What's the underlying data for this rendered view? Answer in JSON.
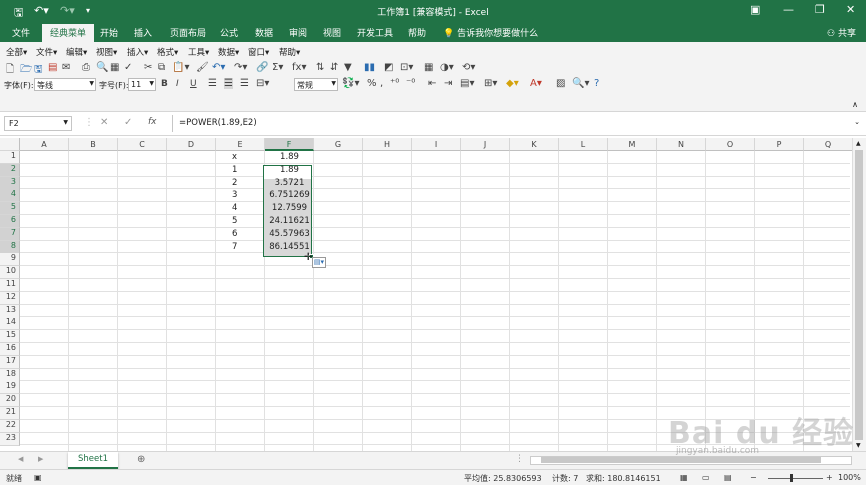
{
  "window": {
    "title": "工作簿1 [兼容模式] - Excel",
    "accent": "#217346"
  },
  "quick_access": {
    "save_icon": "save-icon",
    "undo_icon": "undo-icon",
    "redo_icon": "redo-icon"
  },
  "tabs": [
    "文件",
    "经典菜单",
    "开始",
    "插入",
    "页面布局",
    "公式",
    "数据",
    "审阅",
    "视图",
    "开发工具",
    "帮助"
  ],
  "tell_me": "告诉我你想要做什么",
  "share": "共享",
  "menu": [
    "全部",
    "文件",
    "编辑",
    "视图",
    "插入",
    "格式",
    "工具",
    "数据",
    "窗口",
    "帮助"
  ],
  "toolbar2": {
    "font_label": "字体(F):",
    "font_value": "等线",
    "size_label": "字号(F):",
    "size_value": "11",
    "number_format": "常规",
    "bold": "B",
    "italic": "I",
    "underline": "U"
  },
  "formula_bar": {
    "name_box": "F2",
    "cancel": "✕",
    "enter": "✓",
    "fx": "fx",
    "formula": "=POWER(1.89,E2)"
  },
  "grid": {
    "columns": [
      "A",
      "B",
      "C",
      "D",
      "E",
      "F",
      "G",
      "H",
      "I",
      "J",
      "K",
      "L",
      "M",
      "N",
      "O",
      "P",
      "Q"
    ],
    "selected_column": "F",
    "rows": [
      "1",
      "2",
      "3",
      "4",
      "5",
      "6",
      "7",
      "8",
      "9",
      "10",
      "11",
      "12",
      "13",
      "14",
      "15",
      "16",
      "17",
      "18",
      "19",
      "20",
      "21",
      "22",
      "23"
    ],
    "e_values": [
      "x",
      "1",
      "2",
      "3",
      "4",
      "5",
      "6",
      "7"
    ],
    "f_values": [
      "1.89",
      "1.89",
      "3.5721",
      "6.751269",
      "12.7599",
      "24.11621",
      "45.57963",
      "86.14551"
    ]
  },
  "sheet": {
    "name": "Sheet1",
    "add": "⊕"
  },
  "status": {
    "ready": "就绪",
    "average": "平均值: 25.8306593",
    "count": "计数: 7",
    "sum": "求和: 180.8146151",
    "zoom": "100%"
  },
  "watermark": {
    "text": "Bai du 经验",
    "url": "jingyan.baidu.com"
  }
}
